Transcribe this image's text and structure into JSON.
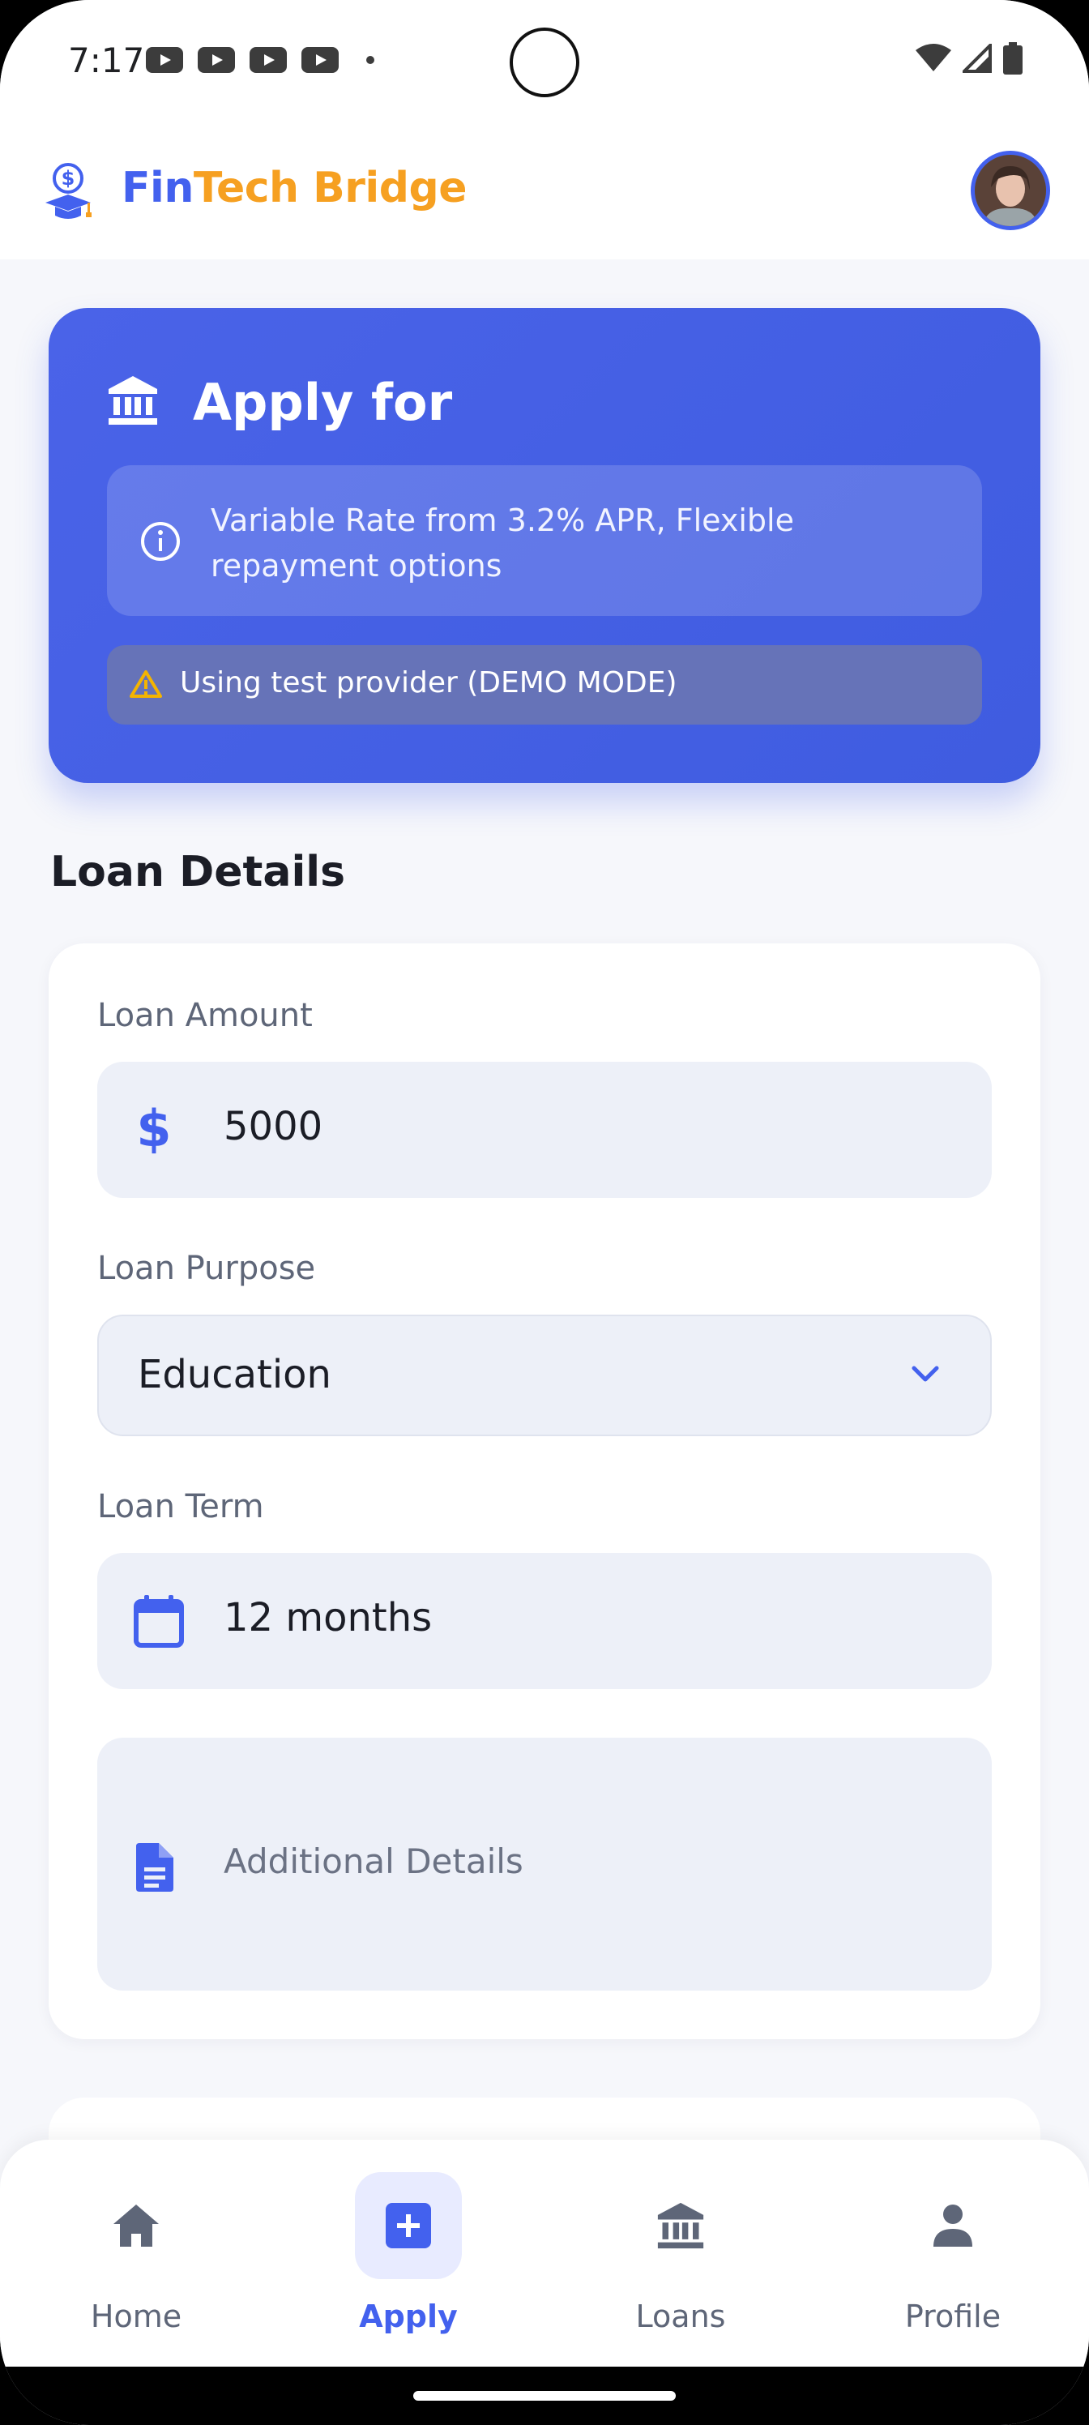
{
  "status_bar": {
    "time": "7:17"
  },
  "header": {
    "brand_fin": "Fin",
    "brand_rest": "Tech Bridge"
  },
  "hero": {
    "title": "Apply for",
    "info_text": "Variable Rate from 3.2% APR, Flexible repayment options",
    "demo_text": "Using test provider (DEMO MODE)"
  },
  "section_title": "Loan Details",
  "form": {
    "amount_label": "Loan Amount",
    "amount_value": "5000",
    "purpose_label": "Loan Purpose",
    "purpose_value": "Education",
    "term_label": "Loan Term",
    "term_value": "12 months",
    "details_placeholder": "Additional Details"
  },
  "bottom_nav": {
    "items": [
      {
        "label": "Home",
        "icon": "home-icon"
      },
      {
        "label": "Apply",
        "icon": "plus-square-icon",
        "active": true
      },
      {
        "label": "Loans",
        "icon": "bank-icon"
      },
      {
        "label": "Profile",
        "icon": "person-icon"
      }
    ]
  },
  "colors": {
    "primary": "#4361ee",
    "accent": "#f6a021",
    "warning": "#f4b400"
  }
}
